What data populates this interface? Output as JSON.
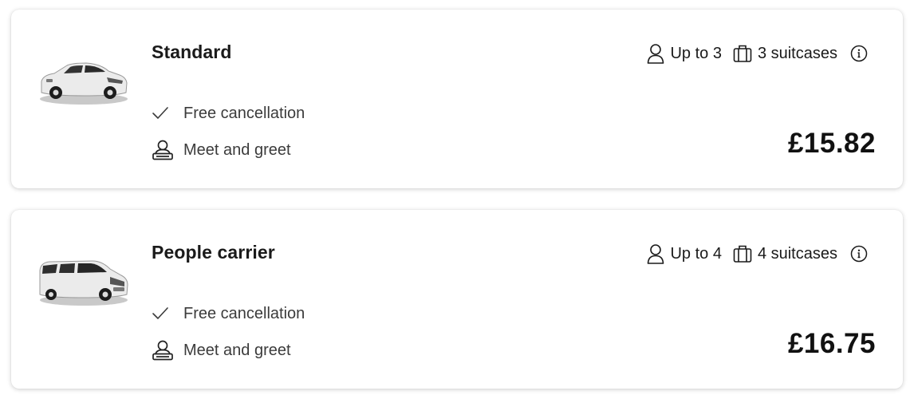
{
  "colors": {
    "text": "#1a1a1a",
    "muted": "#3b3b3b",
    "card_bg": "#ffffff"
  },
  "icons": {
    "passengers": "person-icon",
    "luggage": "suitcase-icon",
    "info": "info-icon",
    "cancellation": "checkmark-icon",
    "meet_greet": "meet-and-greet-icon"
  },
  "vehicles": [
    {
      "name": "Standard",
      "image": "sedan-car-image",
      "passengers": "Up to 3",
      "luggage": "3 suitcases",
      "features": [
        "Free cancellation",
        "Meet and greet"
      ],
      "price": "£15.82"
    },
    {
      "name": "People carrier",
      "image": "people-carrier-van-image",
      "passengers": "Up to 4",
      "luggage": "4 suitcases",
      "features": [
        "Free cancellation",
        "Meet and greet"
      ],
      "price": "£16.75"
    }
  ]
}
